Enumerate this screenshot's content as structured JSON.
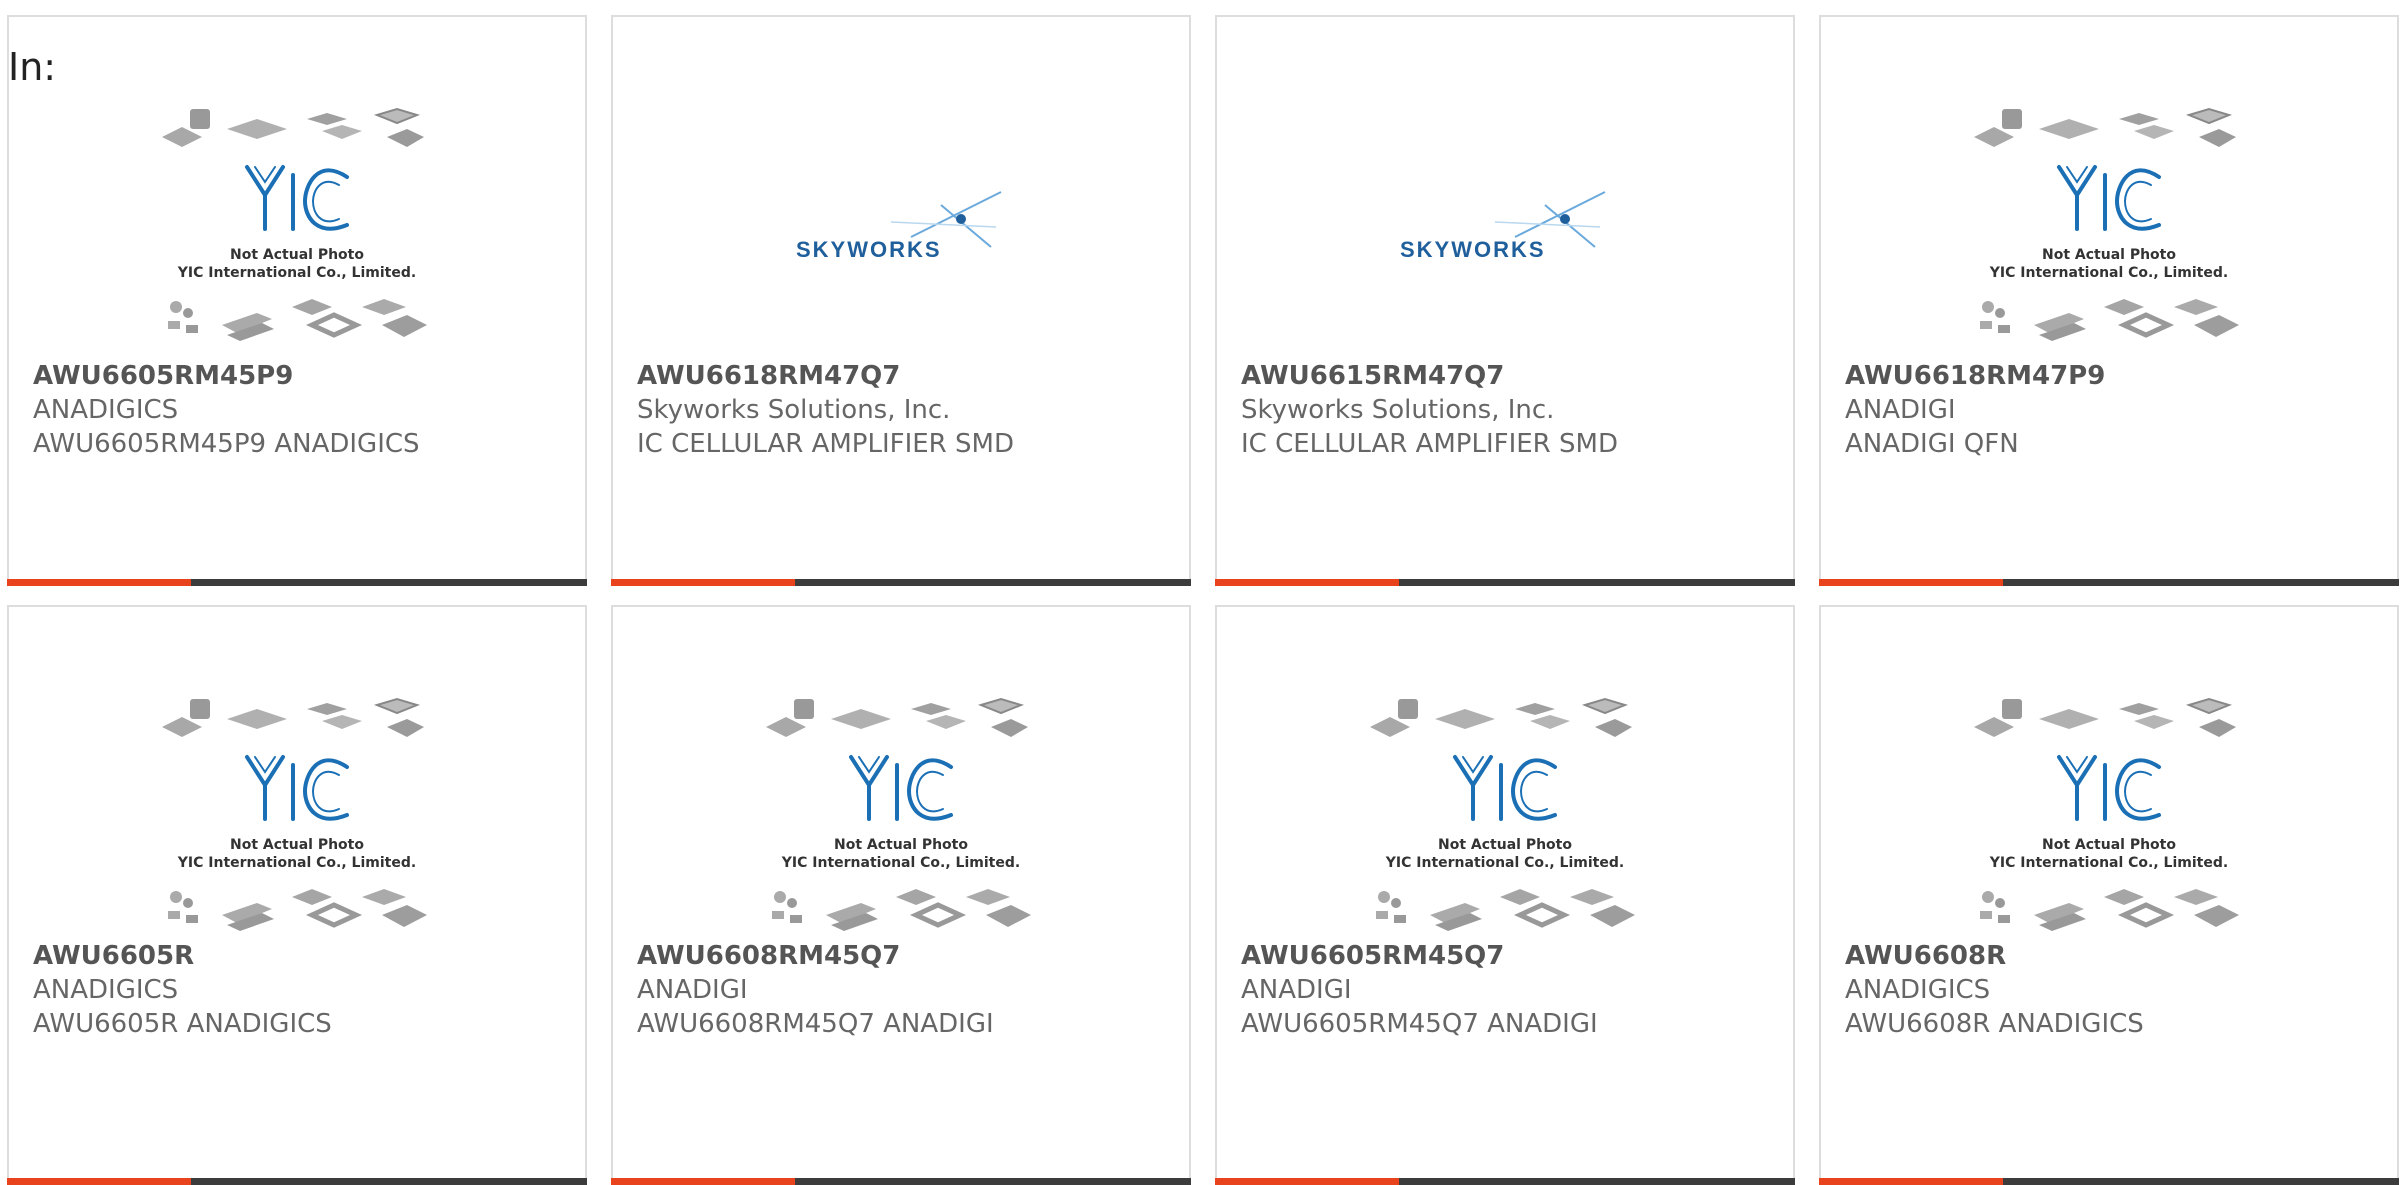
{
  "heading": {
    "in_label": "In:"
  },
  "placeholder_image": {
    "line1": "Not Actual Photo",
    "line2": "YIC International Co., Limited.",
    "logo_text": "YIC"
  },
  "skyworks_logo": {
    "text": "SKYWORKS"
  },
  "colors": {
    "accent": "#e8431c",
    "bar_dark": "#3c3c3c",
    "border": "#dddddd",
    "logo_blue": "#1a6fb5"
  },
  "products": [
    {
      "part_number": "AWU6605RM45P9",
      "manufacturer": "ANADIGICS",
      "description": "AWU6605RM45P9 ANADIGICS",
      "image": "yic-placeholder"
    },
    {
      "part_number": "AWU6618RM47Q7",
      "manufacturer": "Skyworks Solutions, Inc.",
      "description": "IC CELLULAR AMPLIFIER SMD",
      "image": "skyworks-logo"
    },
    {
      "part_number": "AWU6615RM47Q7",
      "manufacturer": "Skyworks Solutions, Inc.",
      "description": "IC CELLULAR AMPLIFIER SMD",
      "image": "skyworks-logo"
    },
    {
      "part_number": "AWU6618RM47P9",
      "manufacturer": "ANADIGI",
      "description": "ANADIGI QFN",
      "image": "yic-placeholder"
    },
    {
      "part_number": "AWU6605R",
      "manufacturer": "ANADIGICS",
      "description": "AWU6605R ANADIGICS",
      "image": "yic-placeholder"
    },
    {
      "part_number": "AWU6608RM45Q7",
      "manufacturer": "ANADIGI",
      "description": "AWU6608RM45Q7 ANADIGI",
      "image": "yic-placeholder"
    },
    {
      "part_number": "AWU6605RM45Q7",
      "manufacturer": "ANADIGI",
      "description": "AWU6605RM45Q7 ANADIGI",
      "image": "yic-placeholder"
    },
    {
      "part_number": "AWU6608R",
      "manufacturer": "ANADIGICS",
      "description": "AWU6608R ANADIGICS",
      "image": "yic-placeholder"
    }
  ]
}
